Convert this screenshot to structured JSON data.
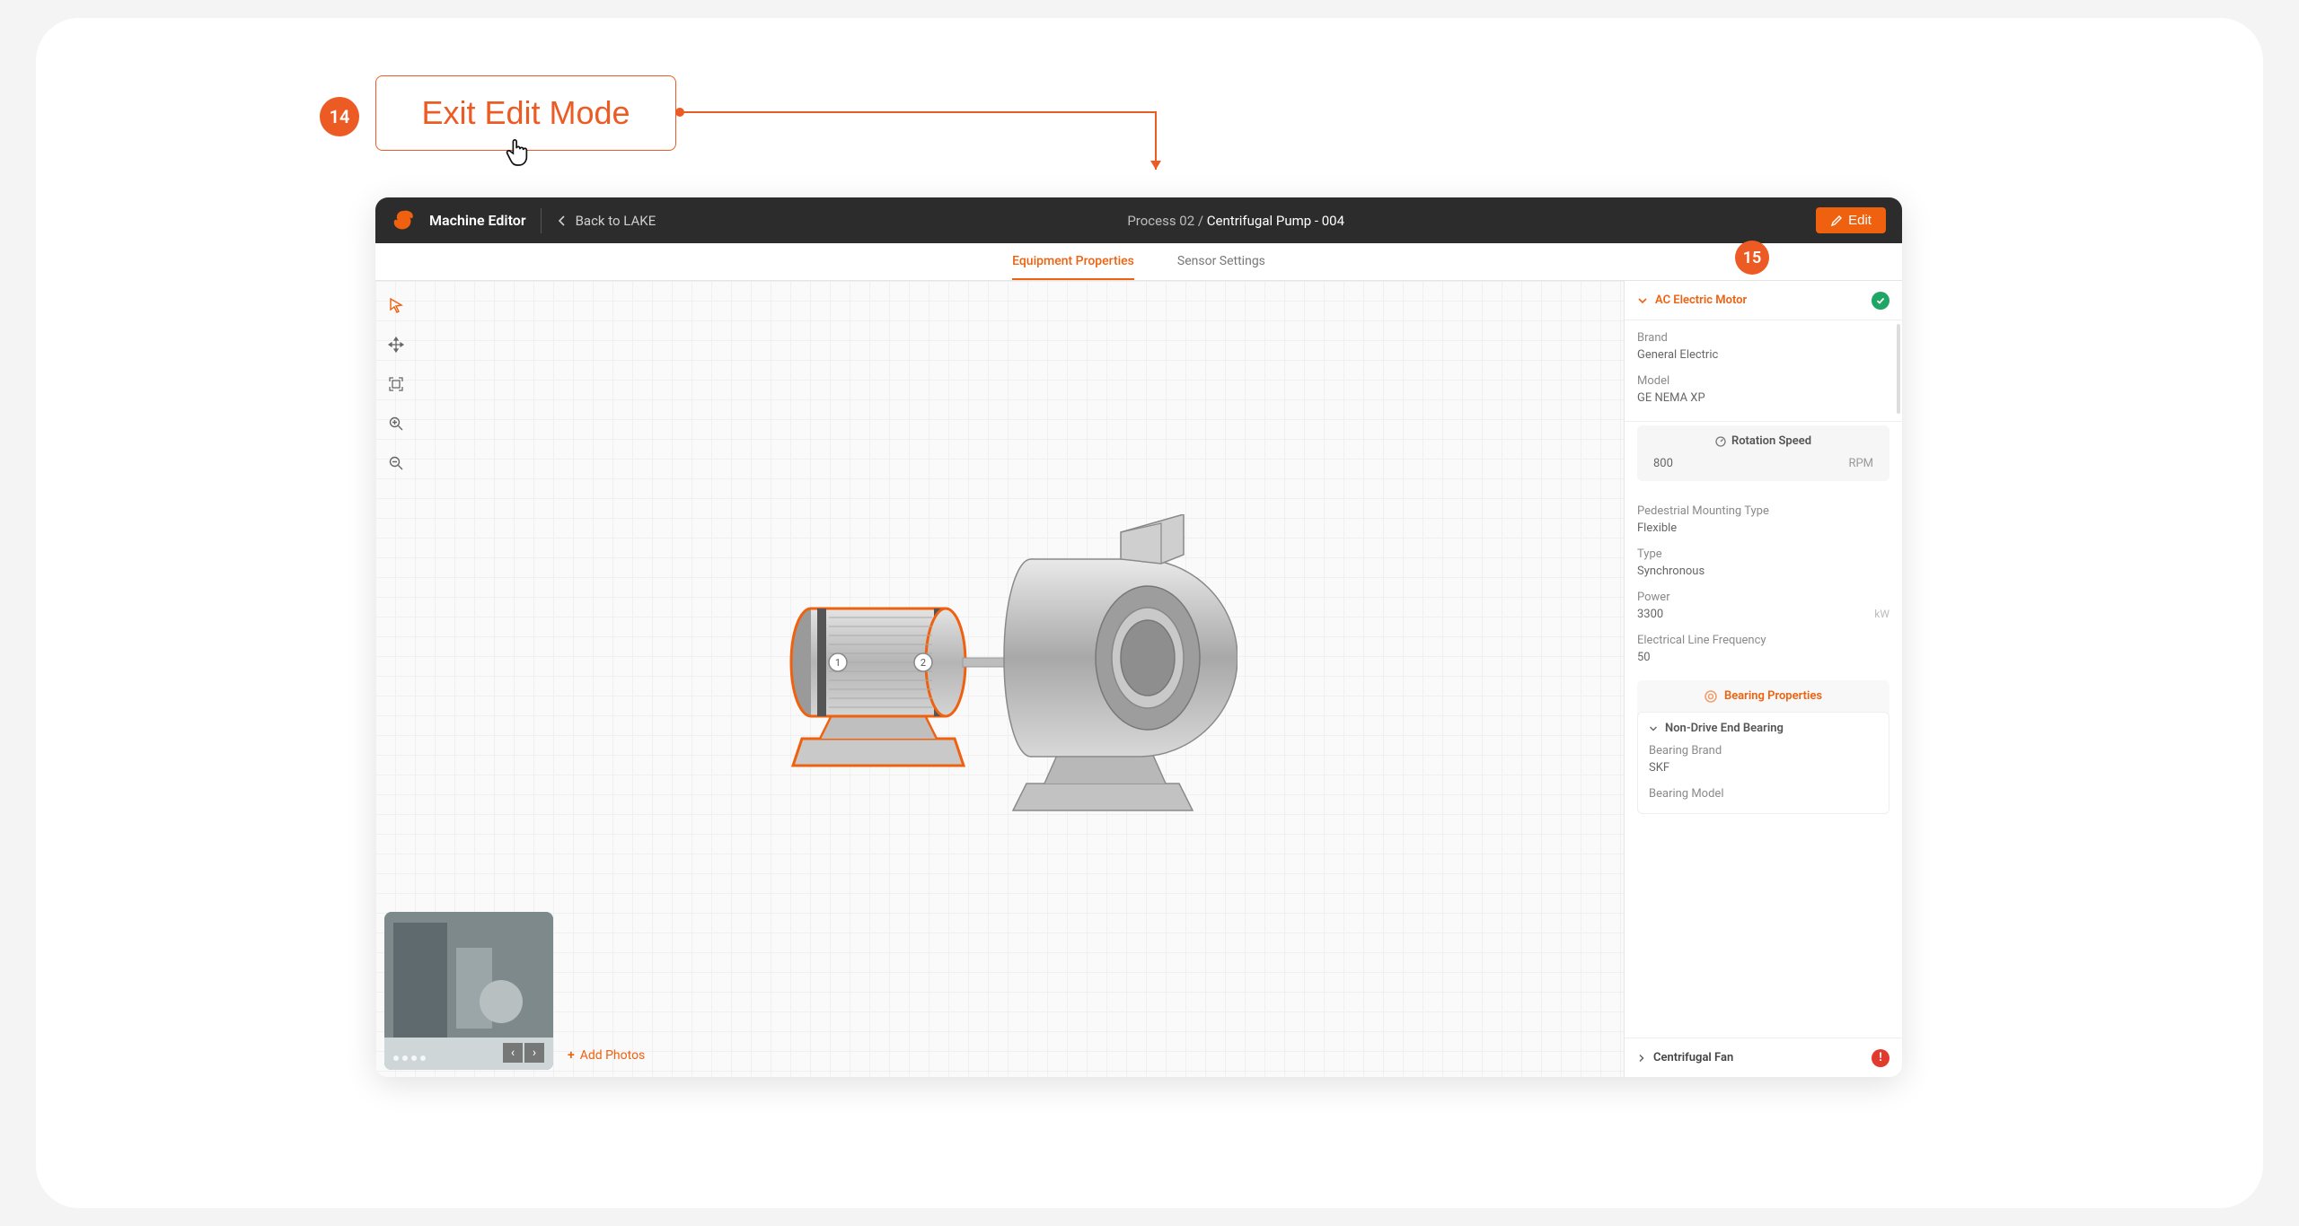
{
  "callout": {
    "step14": "14",
    "step15": "15",
    "exit_label": "Exit Edit Mode"
  },
  "topbar": {
    "app_title": "Machine Editor",
    "back_label": "Back to LAKE",
    "crumb_parent": "Process 02",
    "crumb_sep": " / ",
    "crumb_current": "Centrifugal Pump - 004",
    "edit_label": "Edit"
  },
  "tabs": {
    "equipment": "Equipment Properties",
    "sensor": "Sensor Settings"
  },
  "photos": {
    "add_label": "Add Photos"
  },
  "panel": {
    "section1_title": "AC Electric Motor",
    "fields": {
      "brand_label": "Brand",
      "brand_value": "General Electric",
      "model_label": "Model",
      "model_value": "GE NEMA XP",
      "rotation_title": "Rotation Speed",
      "rotation_value": "800",
      "rotation_unit": "RPM",
      "mount_label": "Pedestrial Mounting Type",
      "mount_value": "Flexible",
      "type_label": "Type",
      "type_value": "Synchronous",
      "power_label": "Power",
      "power_value": "3300",
      "power_unit": "kW",
      "freq_label": "Electrical Line Frequency",
      "freq_value": "50"
    },
    "bearing_title": "Bearing Properties",
    "bearing_sub_title": "Non-Drive End Bearing",
    "bearing_brand_label": "Bearing Brand",
    "bearing_brand_value": "SKF",
    "bearing_model_label": "Bearing Model",
    "section2_title": "Centrifugal Fan"
  }
}
